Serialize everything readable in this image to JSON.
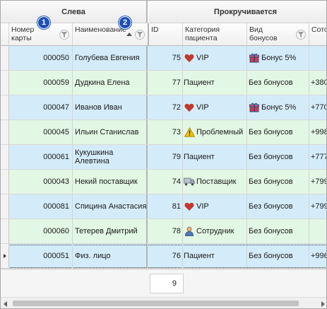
{
  "groups": {
    "left": "Слева",
    "right": "Прокручивается"
  },
  "columns": {
    "num": "Номер карты",
    "name": "Наименование",
    "id": "ID",
    "category": "Категория пациента",
    "bonus": "Вид бонусов",
    "phone": "Сото"
  },
  "badges": {
    "first": "1",
    "second": "2"
  },
  "rows": [
    {
      "num": "000050",
      "name": "Голубева Евгения",
      "id": "75",
      "category": "VIP",
      "category_icon": "heart-icon",
      "bonus": "Бонус 5%",
      "bonus_icon": "gift-icon",
      "phone": ""
    },
    {
      "num": "000059",
      "name": "Дудкина Елена",
      "id": "77",
      "category": "Пациент",
      "category_icon": "",
      "bonus": "Без бонусов",
      "bonus_icon": "",
      "phone": "+380"
    },
    {
      "num": "000047",
      "name": "Иванов Иван",
      "id": "72",
      "category": "VIP",
      "category_icon": "heart-icon",
      "bonus": "Бонус 5%",
      "bonus_icon": "gift-icon",
      "phone": "+770"
    },
    {
      "num": "000045",
      "name": "Ильин Станислав",
      "id": "73",
      "category": "Проблемный",
      "category_icon": "warning-icon",
      "bonus": "Без бонусов",
      "bonus_icon": "",
      "phone": "+998"
    },
    {
      "num": "000061",
      "name": "Кукушкина Алевтина",
      "id": "79",
      "category": "Пациент",
      "category_icon": "",
      "bonus": "Без бонусов",
      "bonus_icon": "",
      "phone": "+777"
    },
    {
      "num": "000043",
      "name": "Некий поставщик",
      "id": "74",
      "category": "Поставщик",
      "category_icon": "truck-icon",
      "bonus": "Без бонусов",
      "bonus_icon": "",
      "phone": "+799"
    },
    {
      "num": "000081",
      "name": "Спицина Анастасия",
      "id": "81",
      "category": "VIP",
      "category_icon": "heart-icon",
      "bonus": "Без бонусов",
      "bonus_icon": "",
      "phone": "+799"
    },
    {
      "num": "000060",
      "name": "Тетерев Дмитрий",
      "id": "78",
      "category": "Сотрудник",
      "category_icon": "person-icon",
      "bonus": "Без бонусов",
      "bonus_icon": "",
      "phone": ""
    },
    {
      "num": "000051",
      "name": "Физ. лицо",
      "id": "76",
      "category": "Пациент",
      "category_icon": "",
      "bonus": "Без бонусов",
      "bonus_icon": "",
      "phone": "+996"
    }
  ],
  "footer": {
    "count": "9"
  },
  "colors": {
    "row_blue": "#d4ecfa",
    "row_green": "#e2f7e4",
    "badge": "#1e50b4",
    "heart": "#c0392b"
  }
}
